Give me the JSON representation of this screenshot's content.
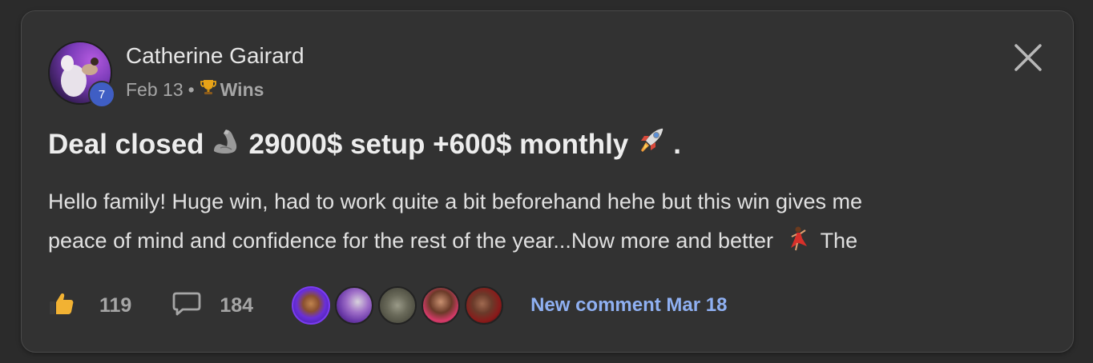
{
  "post": {
    "author": "Catherine Gairard",
    "level": "7",
    "date": "Feb 13",
    "separator": "•",
    "category": "Wins",
    "title_part1": "Deal closed",
    "title_part2": "29000$ setup +600$ monthly",
    "title_part3": ".",
    "body_line1": "Hello family! Huge win, had to work quite a bit beforehand hehe but this win gives me",
    "body_line2": "peace of mind and confidence for the rest of the year...Now more and better",
    "body_line3": "The",
    "likes": "119",
    "comments": "184",
    "new_comment": "New comment Mar 18"
  },
  "icons": {
    "close": "close-icon",
    "trophy": "trophy-icon",
    "muscle": "flexed-biceps-icon",
    "rocket": "rocket-icon",
    "dancer": "dancer-icon",
    "like": "thumbs-up-icon",
    "comment": "comment-bubble-icon"
  },
  "colors": {
    "background": "#2b2b2b",
    "card": "#323232",
    "level_badge": "#3f5ec4",
    "link": "#8fb0f2",
    "like_icon": "#f2b233"
  }
}
